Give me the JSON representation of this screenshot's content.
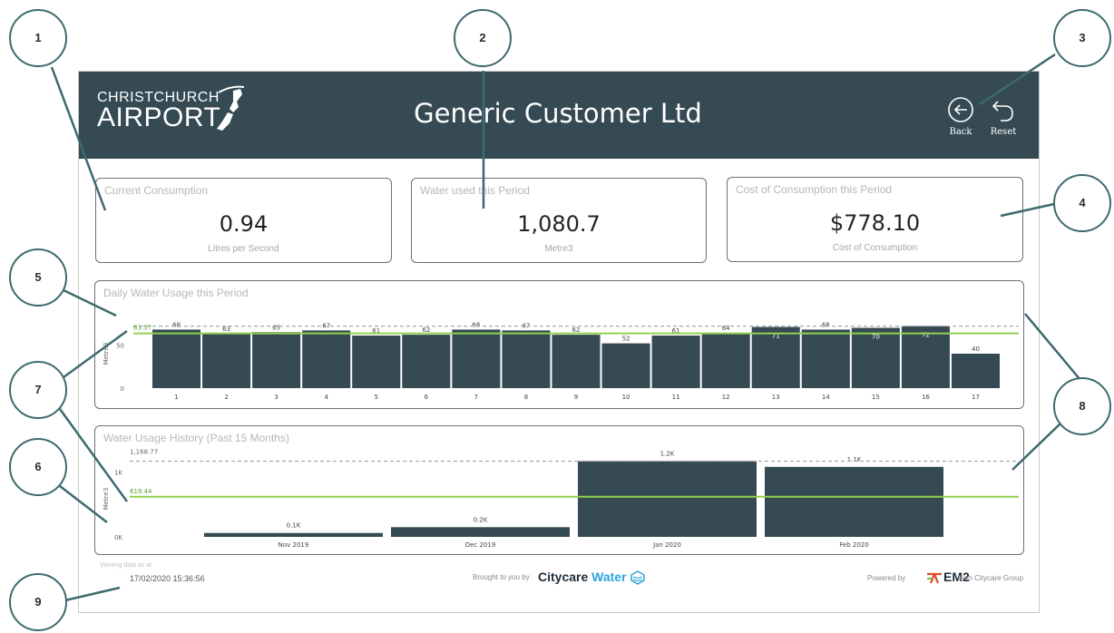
{
  "header": {
    "logo_line1": "CHRISTCHURCH",
    "logo_line2": "AIRPORT",
    "title": "Generic Customer Ltd",
    "back_label": "Back",
    "reset_label": "Reset",
    "bg_color": "#354a53"
  },
  "cards": [
    {
      "title": "Current Consumption",
      "value": "0.94",
      "unit": "Litres per Second"
    },
    {
      "title": "Water used this Period",
      "value": "1,080.7",
      "unit": "Metre3"
    },
    {
      "title": "Cost of Consumption this Period",
      "value": "$778.10",
      "unit": "Cost of Consumption"
    }
  ],
  "chart_data": [
    {
      "type": "bar",
      "title": "Daily Water Usage this Period",
      "ylabel": "Metre3",
      "yticks": [
        "0",
        "50"
      ],
      "ylim": [
        0,
        80
      ],
      "categories": [
        "1",
        "2",
        "3",
        "4",
        "5",
        "6",
        "7",
        "8",
        "9",
        "10",
        "11",
        "12",
        "13",
        "14",
        "15",
        "16",
        "17"
      ],
      "values": [
        68,
        63,
        65,
        67,
        61,
        62,
        68,
        67,
        62,
        52,
        61,
        64,
        71,
        68,
        70,
        72,
        40
      ],
      "average": 63.57,
      "average_label": "63.57",
      "max_line": 72,
      "bar_color": "#354a53",
      "average_color": "#92d050"
    },
    {
      "type": "bar",
      "title": "Water Usage History (Past 15 Months)",
      "ylabel": "Metre3",
      "yticks": [
        "0K",
        "1K"
      ],
      "ylim": [
        0,
        1400
      ],
      "categories": [
        "Nov 2019",
        "Dec 2019",
        "Jan 2020",
        "Feb 2020"
      ],
      "values": [
        60,
        150,
        1168.77,
        1080.7
      ],
      "value_labels": [
        "0.1K",
        "0.2K",
        "1.2K",
        "1.1K"
      ],
      "average": 619.44,
      "average_label": "619.44",
      "max_line": 1168.77,
      "max_label": "1,168.77",
      "bar_color": "#354a53",
      "average_color": "#92d050"
    }
  ],
  "footer": {
    "viewing_label": "Viewing data as at",
    "timestamp": "17/02/2020 15:36:56",
    "brought_by": "Brought to you by",
    "brand_citycare": "Citycare",
    "brand_water": "Water",
    "powered_by": "Powered by",
    "brand_em2": "EM2",
    "from_group": "from Citycare Group"
  },
  "callouts": [
    "1",
    "2",
    "3",
    "4",
    "5",
    "6",
    "7",
    "8",
    "9"
  ]
}
